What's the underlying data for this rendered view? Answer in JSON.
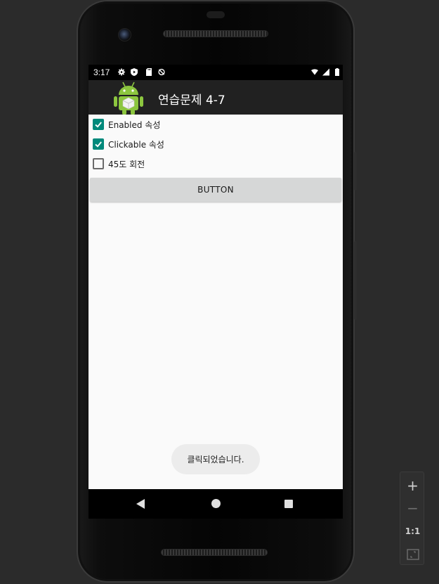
{
  "statusbar": {
    "time": "3:17",
    "icons": [
      "gear-icon",
      "play-protect-icon",
      "sd-card-icon",
      "no-sync-icon",
      "wifi-icon",
      "signal-icon",
      "battery-icon"
    ]
  },
  "app": {
    "title": "연습문제 4-7",
    "logo_icon": "android-logo-icon"
  },
  "checkboxes": [
    {
      "label": "Enabled 속성",
      "checked": true
    },
    {
      "label": "Clickable 속성",
      "checked": true
    },
    {
      "label": "45도 회전",
      "checked": false
    }
  ],
  "button": {
    "label": "BUTTON"
  },
  "toast": {
    "text": "클릭되었습니다."
  },
  "navbar": {
    "icons": [
      "back-icon",
      "home-icon",
      "recents-icon"
    ]
  },
  "zoom_controls": {
    "plus": "+",
    "minus": "−",
    "one_to_one": "1:1",
    "fit_icon": "fit-screen-icon"
  },
  "colors": {
    "accent": "#00897b",
    "appbar": "#212121",
    "content_bg": "#fafafa",
    "button_bg": "#d6d7d7"
  }
}
